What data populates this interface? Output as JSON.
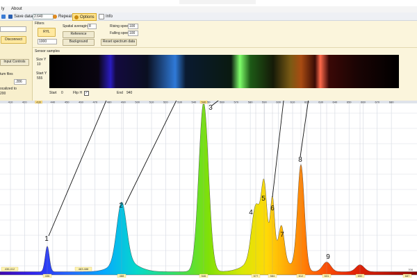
{
  "menu": {
    "items": [
      "ly",
      "About"
    ]
  },
  "toolbar": {
    "save_label": "Save data file",
    "file_field_value": "2.640",
    "repeat_label": "Repeat",
    "options_label": "Options",
    "info_label": "Info"
  },
  "left_panel": {
    "disconnect_label": "Disconnect",
    "input_controls_label": "Input Controls",
    "files_label": "tum files",
    "select_value": ".286",
    "note_line1": "ocalized to",
    "note_line2": "200"
  },
  "filters": {
    "section_label": "Filters",
    "mode_button_label": "RYL",
    "select_value": "1000",
    "spatial_label": "Spatial averaging",
    "spatial_value": "8",
    "reference_label": "Reference",
    "background_label": "Background",
    "rising_label": "Rising speed",
    "rising_value": "100",
    "falling_label": "Falling speed",
    "falling_value": "100",
    "reset_label": "Reset spectrum data"
  },
  "sensor": {
    "section_label": "Sensor samples",
    "sizey_label": "Size Y",
    "sizey_value": "10",
    "starty_label": "Start Y",
    "starty_value": "555",
    "start_label": "Start",
    "start_value": "0",
    "flipx_label": "Flip H",
    "end_label": "End",
    "end_value": "940"
  },
  "axis_ticks": [
    "410",
    "420",
    "430",
    "440",
    "450",
    "460",
    "470",
    "480",
    "490",
    "500",
    "510",
    "520",
    "530",
    "540",
    "550",
    "560",
    "570",
    "580",
    "590",
    "600",
    "610",
    "620",
    "630",
    "640",
    "650",
    "660",
    "670",
    "680"
  ],
  "highlight_tick": "430",
  "top_marker_label": "546",
  "peak_labels": [
    "1",
    "2",
    "3",
    "4",
    "5",
    "6",
    "7",
    "8",
    "9"
  ],
  "bottom_labels": [
    "436",
    "488",
    "546",
    "577",
    "584",
    "612",
    "631",
    "650",
    "687"
  ],
  "bottom_left_labels": [
    "436.412",
    "483.488"
  ],
  "bottom_right_label": "700",
  "colors": {
    "accent_yellow": "#ffe28a",
    "panel_bg": "#fbf5dc",
    "grid": "#c8ced8"
  }
}
